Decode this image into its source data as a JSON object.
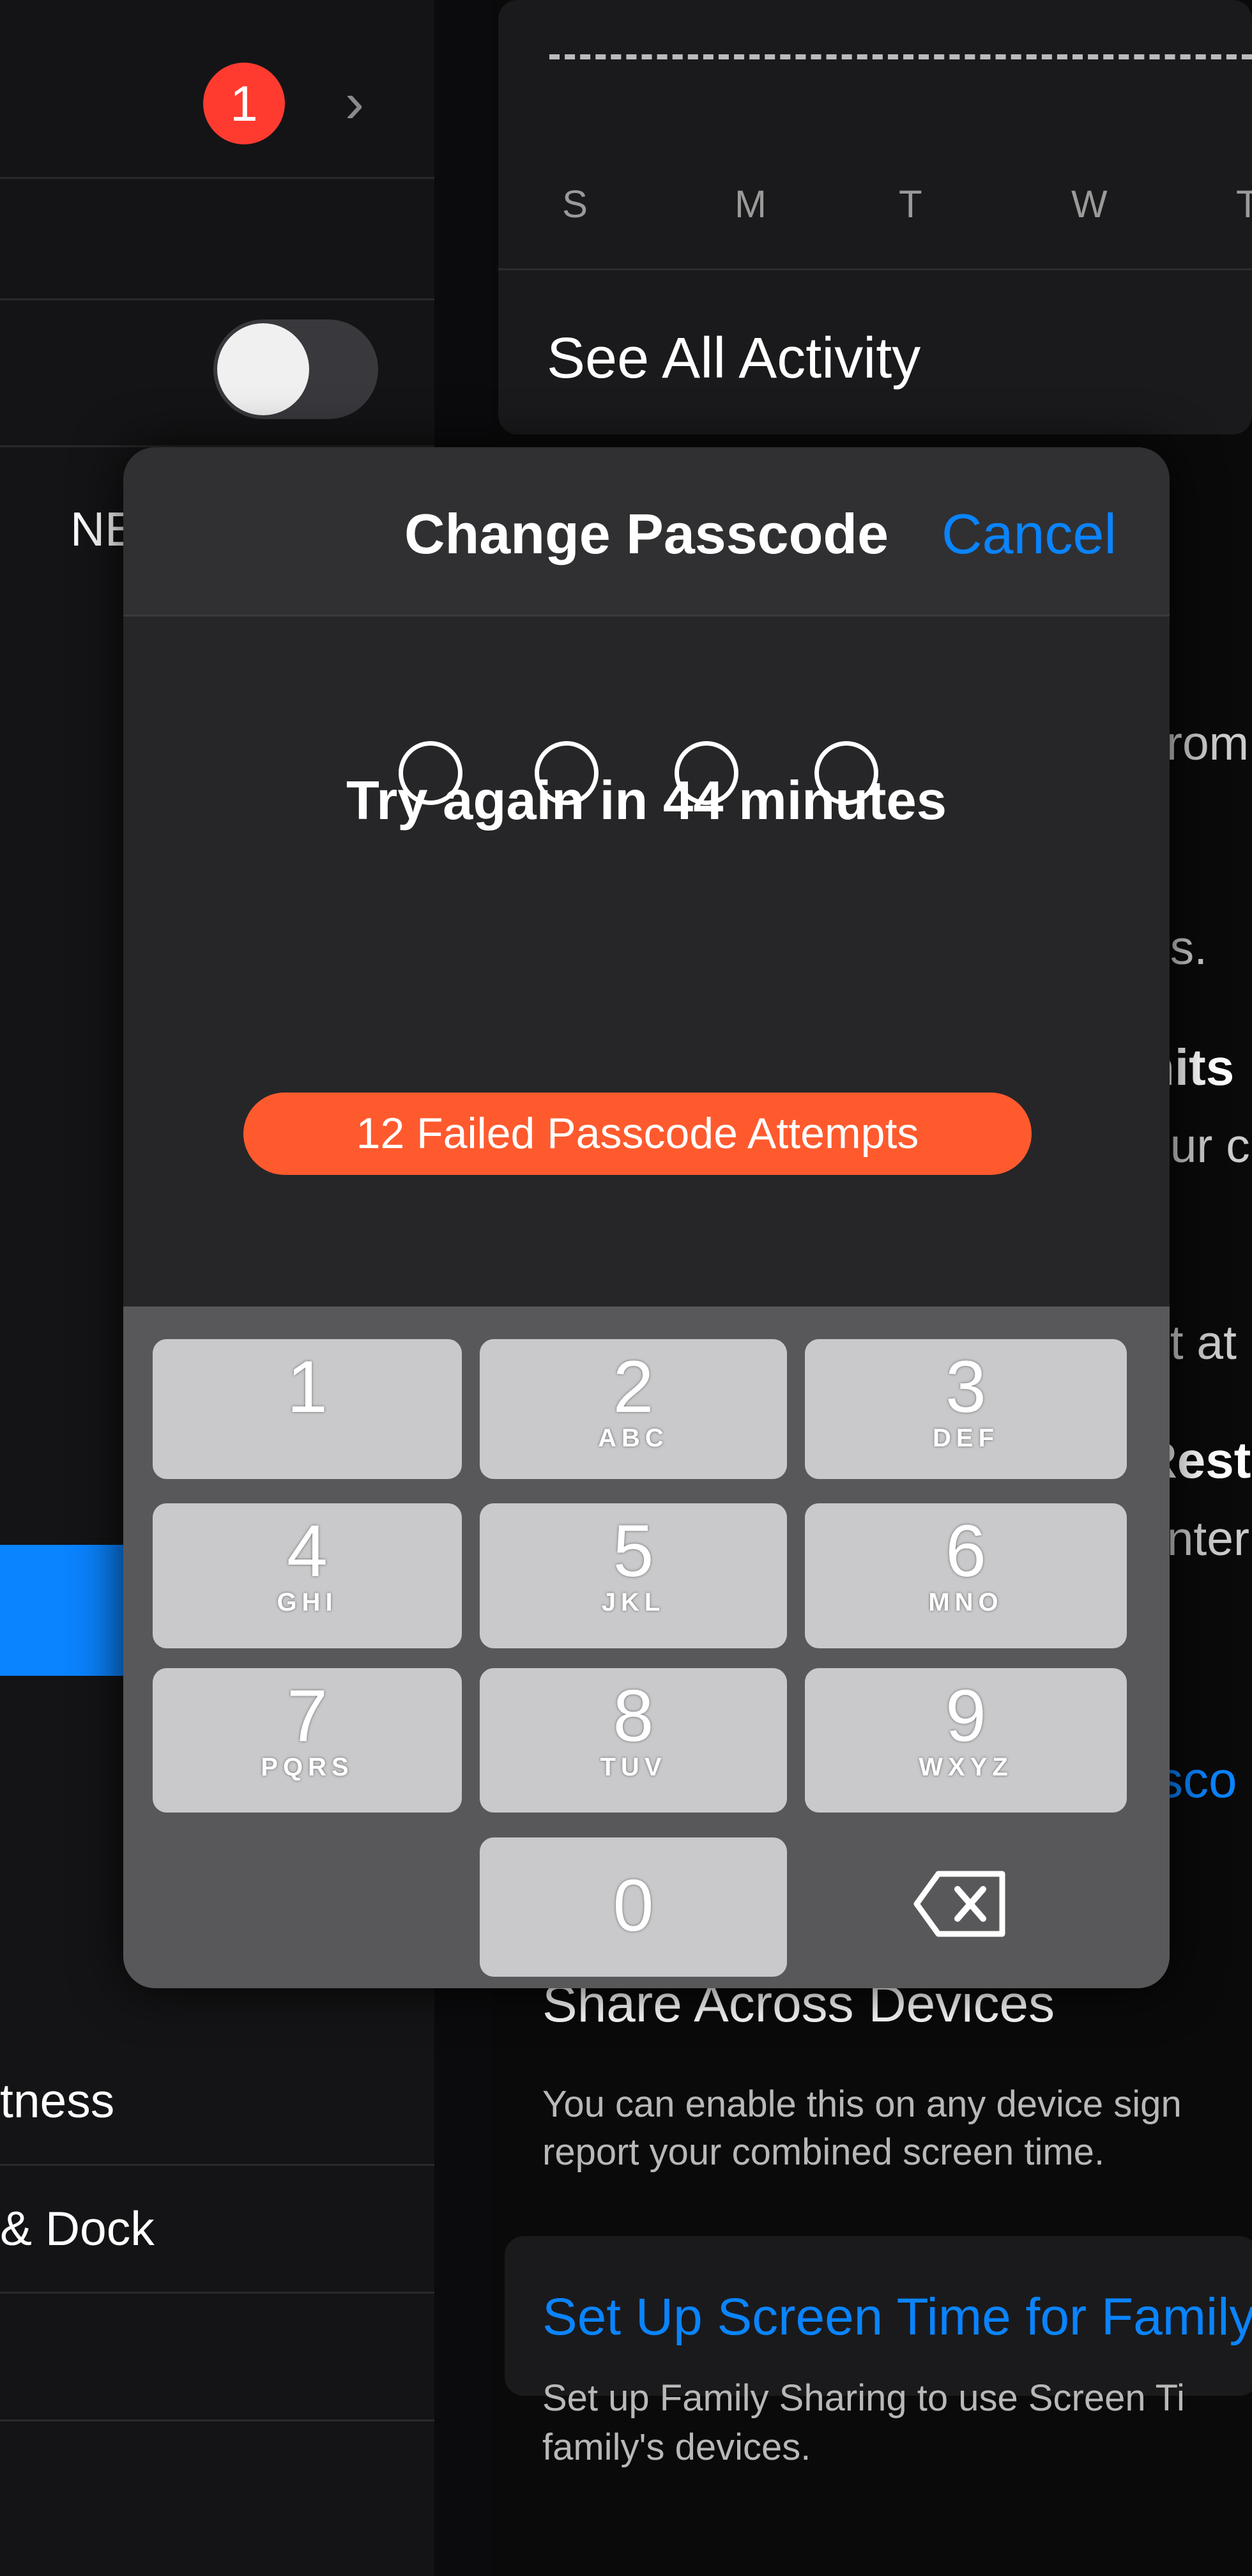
{
  "sidebar": {
    "badge": "1",
    "partial_label": "NE",
    "items": [
      "tness",
      "& Dock"
    ],
    "toggle_on": false
  },
  "activity": {
    "days": [
      "S",
      "M",
      "T",
      "W",
      "T"
    ],
    "see_all": "See All Activity"
  },
  "background_fragments": [
    "rom",
    "ps.",
    "nits",
    "our c",
    "nt at",
    "Restr",
    "onter",
    "ssco"
  ],
  "share": {
    "title": "Share Across Devices",
    "desc1": "You can enable this on any device sign",
    "desc2": "report your combined screen time."
  },
  "family": {
    "link": "Set Up Screen Time for Family",
    "desc1": "Set up Family Sharing to use Screen Ti",
    "desc2": "family's devices."
  },
  "modal": {
    "title": "Change Passcode",
    "cancel": "Cancel",
    "message": "Try again in 44 minutes",
    "failed": "12 Failed Passcode Attempts",
    "digits_entered": 0,
    "digits_total": 4
  },
  "keypad": [
    {
      "d": "1",
      "l": ""
    },
    {
      "d": "2",
      "l": "ABC"
    },
    {
      "d": "3",
      "l": "DEF"
    },
    {
      "d": "4",
      "l": "GHI"
    },
    {
      "d": "5",
      "l": "JKL"
    },
    {
      "d": "6",
      "l": "MNO"
    },
    {
      "d": "7",
      "l": "PQRS"
    },
    {
      "d": "8",
      "l": "TUV"
    },
    {
      "d": "9",
      "l": "WXYZ"
    },
    {
      "d": "0",
      "l": ""
    }
  ],
  "colors": {
    "accent": "#0a84ff",
    "alert": "#ff5a2e",
    "badge": "#ff3b30"
  }
}
